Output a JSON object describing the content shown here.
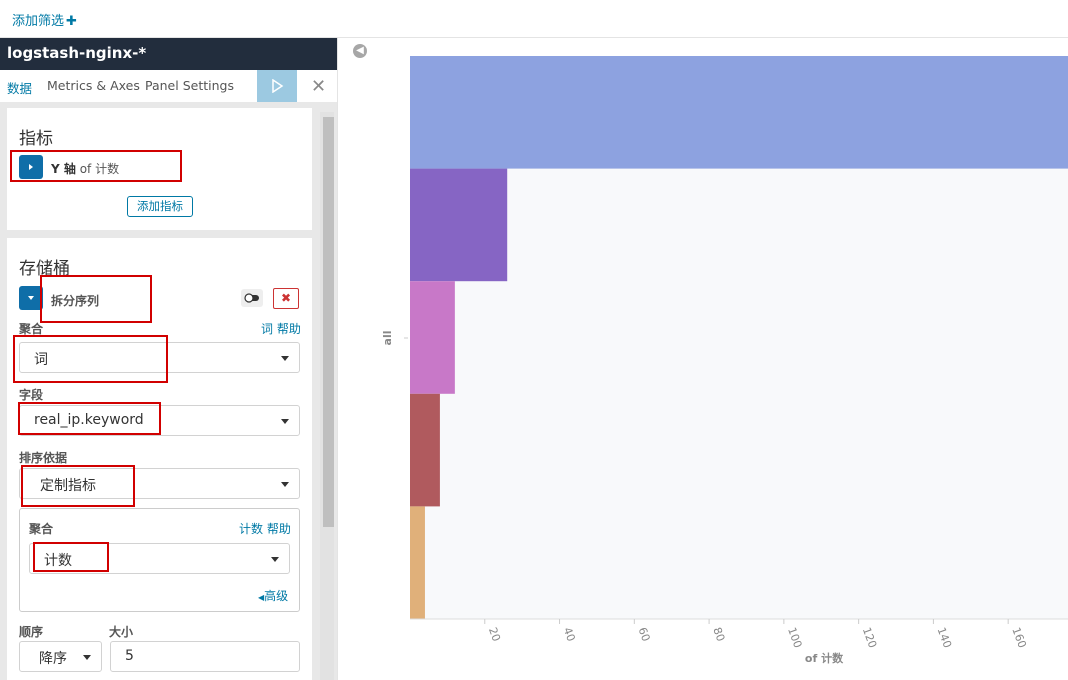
{
  "topbar": {
    "add_filter": "添加筛选"
  },
  "sidebar": {
    "index_pattern": "logstash-nginx-*",
    "tabs": [
      "数据",
      "Metrics & Axes",
      "Panel Settings"
    ],
    "metrics": {
      "title": "指标",
      "yaxis_bold": "Y 轴",
      "yaxis_rest": "of 计数",
      "add_metric": "添加指标"
    },
    "buckets": {
      "title": "存储桶",
      "split_series": "拆分序列",
      "aggregation_label": "聚合",
      "aggregation_help": "词 帮助",
      "aggregation_value": "词",
      "field_label": "字段",
      "field_value": "real_ip.keyword",
      "order_by_label": "排序依据",
      "order_by_value": "定制指标",
      "sub": {
        "aggregation_label": "聚合",
        "aggregation_help": "计数 帮助",
        "aggregation_value": "计数",
        "advanced": "高级"
      },
      "order_label": "顺序",
      "size_label": "大小",
      "order_value": "降序",
      "size_value": "5"
    }
  },
  "chart_data": {
    "type": "bar",
    "orientation": "horizontal",
    "ylabel": "all",
    "xlabel": "of 计数",
    "x_ticks": [
      "20",
      "40",
      "60",
      "80",
      "100",
      "120",
      "140",
      "160"
    ],
    "xlim": [
      0,
      176
    ],
    "series": [
      {
        "values": [
          176
        ],
        "color": "#8da2e0"
      },
      {
        "values": [
          26
        ],
        "color": "#8665c4"
      },
      {
        "values": [
          12
        ],
        "color": "#c878c8"
      },
      {
        "values": [
          8
        ],
        "color": "#b05a5e"
      },
      {
        "values": [
          4
        ],
        "color": "#e0b07a"
      }
    ]
  }
}
